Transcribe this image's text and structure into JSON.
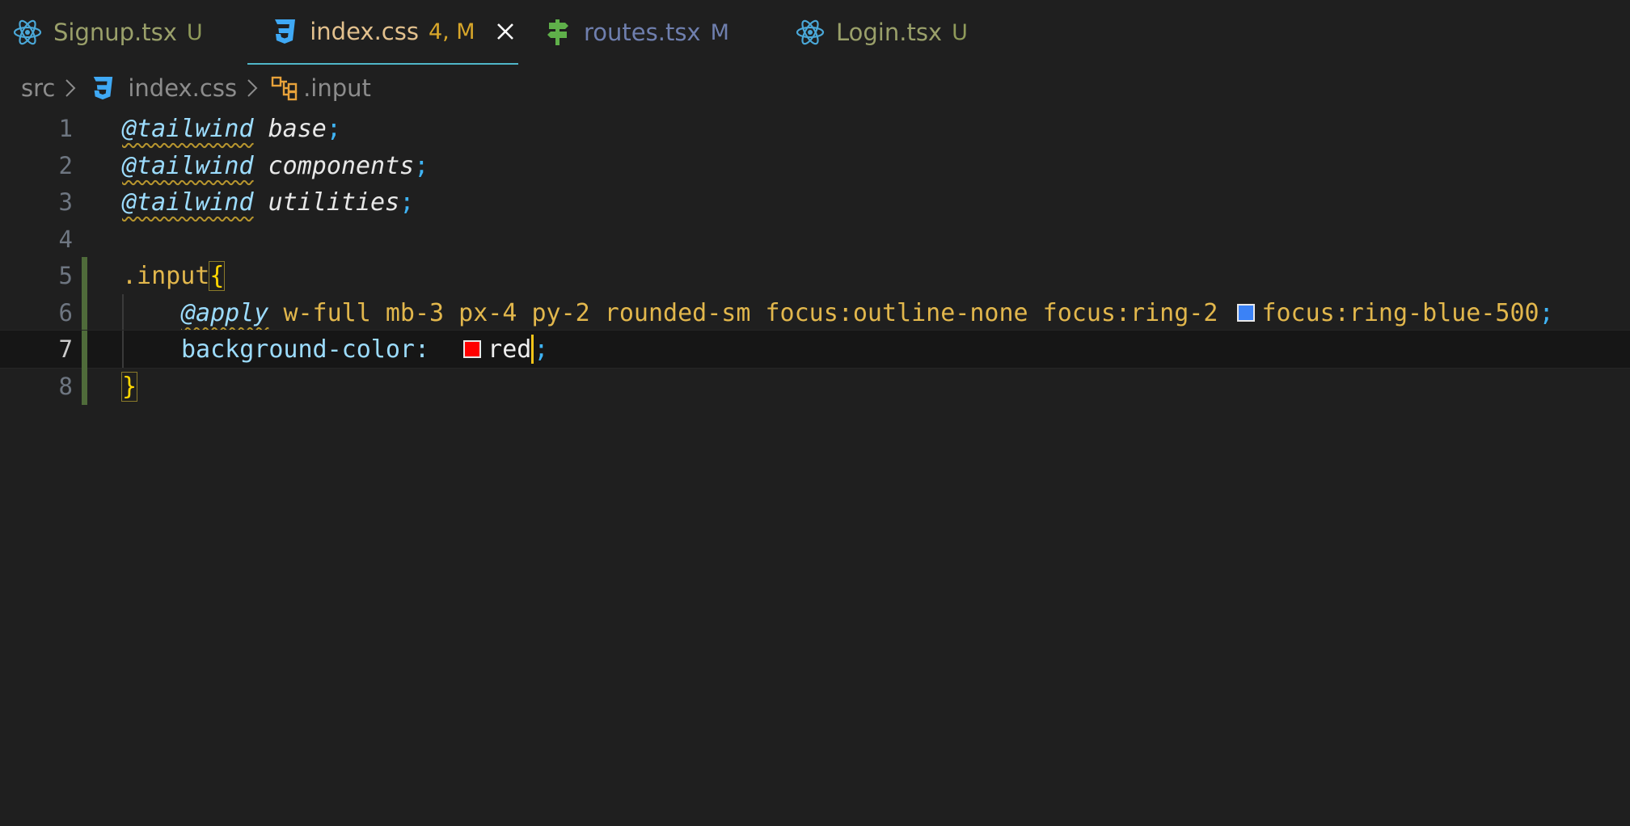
{
  "tabs": [
    {
      "label": "Signup.tsx",
      "status": "U",
      "icon": "react-icon",
      "color": "#9aa06a",
      "status_color": "#8f9a5a"
    },
    {
      "label": "index.css",
      "status": "4, M",
      "icon": "css3-icon",
      "color": "#e2c08d",
      "status_color": "#d7a62a",
      "active": true
    },
    {
      "label": "routes.tsx",
      "status": "M",
      "icon": "signpost-icon",
      "color": "#6f7fae",
      "status_color": "#6f7fae"
    },
    {
      "label": "Login.tsx",
      "status": "U",
      "icon": "react-icon",
      "color": "#9aa06a",
      "status_color": "#8f9a5a"
    }
  ],
  "breadcrumb": {
    "folder": "src",
    "file": "index.css",
    "symbol": ".input"
  },
  "editor": {
    "line_numbers": [
      "1",
      "2",
      "3",
      "4",
      "5",
      "6",
      "7",
      "8"
    ],
    "line1": {
      "at": "@tailwind",
      "arg": "base",
      "semi": ";"
    },
    "line2": {
      "at": "@tailwind",
      "arg": "components",
      "semi": ";"
    },
    "line3": {
      "at": "@tailwind",
      "arg": "utilities",
      "semi": ";"
    },
    "line5": {
      "selector": ".input",
      "brace": "{"
    },
    "line6": {
      "at": "@apply",
      "classes": "w-full mb-3 px-4 py-2 rounded-sm focus:outline-none focus:ring-2",
      "classes2": "focus:ring-blue-500",
      "semi": ";",
      "swatch_color": "#3b82f6"
    },
    "line7": {
      "prop": "background-color:",
      "value": "red",
      "semi": ";",
      "swatch_color": "#ff0000"
    },
    "line8": {
      "brace": "}"
    }
  },
  "colors": {
    "background": "#1f1f1f",
    "active_tab_border": "#4fb6c9",
    "cursor": "#f5c518"
  }
}
